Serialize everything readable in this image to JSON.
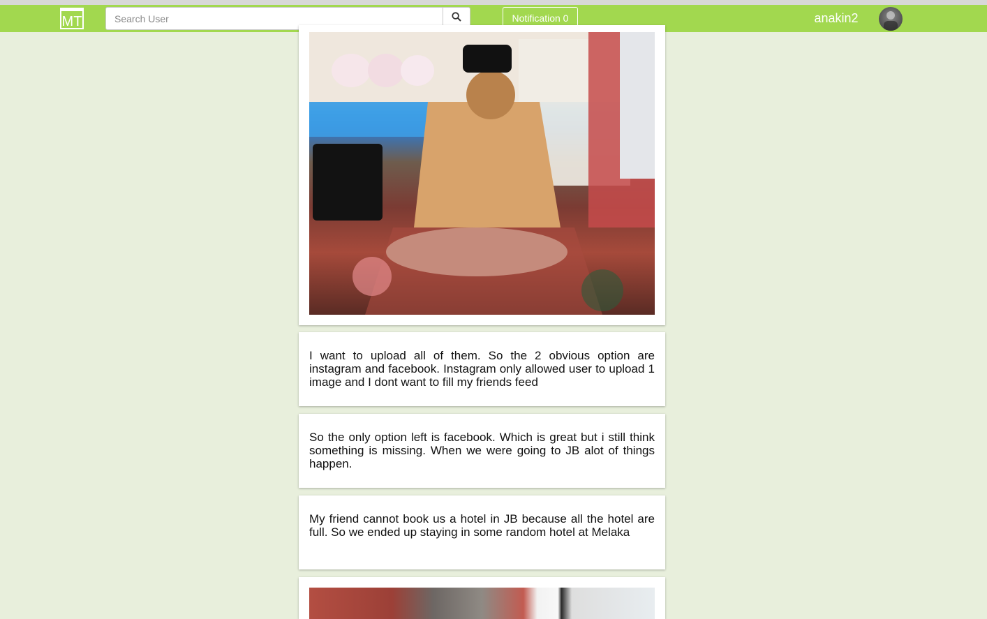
{
  "header": {
    "logo_text": "MT",
    "search_placeholder": "Search User",
    "notification_label": "Notification 0",
    "username": "anakin2"
  },
  "feed": {
    "posts": [
      {
        "type": "image"
      },
      {
        "type": "text",
        "text": "I want to upload all of them. So the 2 obvious option are instagram and facebook. Instagram only allowed user to upload 1 image and I dont want to fill my friends feed"
      },
      {
        "type": "text",
        "text": "So the only option left is facebook. Which is great but i still think something is missing. When we were going to JB alot of things happen."
      },
      {
        "type": "text",
        "text": "My friend cannot book us a hotel in JB because all the hotel are full. So we ended up staying in some random hotel at Melaka"
      },
      {
        "type": "image"
      }
    ]
  },
  "colors": {
    "navbar": "#a2d84f",
    "background": "#e8efdc"
  },
  "icons": {
    "search": "search-icon",
    "logo": "mt-logo-icon",
    "avatar": "user-avatar"
  }
}
